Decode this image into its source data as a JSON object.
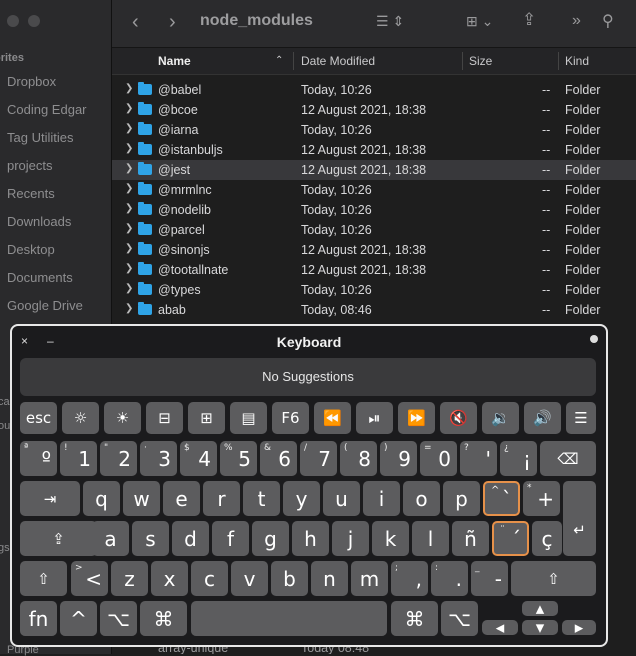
{
  "window": {
    "title": "node_modules"
  },
  "sidebar": {
    "section": "orites",
    "items": [
      "Dropbox",
      "Coding Edgar",
      "Tag Utilities",
      "projects",
      "Recents",
      "Downloads",
      "Desktop",
      "Documents",
      "Google Drive"
    ],
    "fragments": [
      "ca",
      "ou",
      "gs",
      "Purple"
    ]
  },
  "columns": {
    "name": "Name",
    "date": "Date Modified",
    "size": "Size",
    "kind": "Kind"
  },
  "rows": [
    {
      "name": "@babel",
      "date": "Today, 10:26",
      "size": "--",
      "kind": "Folder"
    },
    {
      "name": "@bcoe",
      "date": "12 August 2021, 18:38",
      "size": "--",
      "kind": "Folder"
    },
    {
      "name": "@iarna",
      "date": "Today, 10:26",
      "size": "--",
      "kind": "Folder"
    },
    {
      "name": "@istanbuljs",
      "date": "12 August 2021, 18:38",
      "size": "--",
      "kind": "Folder"
    },
    {
      "name": "@jest",
      "date": "12 August 2021, 18:38",
      "size": "--",
      "kind": "Folder",
      "selected": true
    },
    {
      "name": "@mrmlnc",
      "date": "Today, 10:26",
      "size": "--",
      "kind": "Folder"
    },
    {
      "name": "@nodelib",
      "date": "Today, 10:26",
      "size": "--",
      "kind": "Folder"
    },
    {
      "name": "@parcel",
      "date": "Today, 10:26",
      "size": "--",
      "kind": "Folder"
    },
    {
      "name": "@sinonjs",
      "date": "12 August 2021, 18:38",
      "size": "--",
      "kind": "Folder"
    },
    {
      "name": "@tootallnate",
      "date": "12 August 2021, 18:38",
      "size": "--",
      "kind": "Folder"
    },
    {
      "name": "@types",
      "date": "Today, 10:26",
      "size": "--",
      "kind": "Folder"
    },
    {
      "name": "abab",
      "date": "Today, 08:46",
      "size": "--",
      "kind": "Folder"
    }
  ],
  "bottom_row": {
    "name": "array-unique",
    "date": "Today 08:48"
  },
  "keyboard": {
    "title": "Keyboard",
    "close": "×",
    "minimize": "–",
    "suggestions": "No Suggestions",
    "fn_row": [
      "esc",
      "F6"
    ],
    "num_row": [
      {
        "main": "º",
        "alt": "ª"
      },
      {
        "main": "1",
        "alt": "!"
      },
      {
        "main": "2",
        "alt": "\""
      },
      {
        "main": "3",
        "alt": "·"
      },
      {
        "main": "4",
        "alt": "$"
      },
      {
        "main": "5",
        "alt": "%"
      },
      {
        "main": "6",
        "alt": "&"
      },
      {
        "main": "7",
        "alt": "/"
      },
      {
        "main": "8",
        "alt": "("
      },
      {
        "main": "9",
        "alt": ")"
      },
      {
        "main": "0",
        "alt": "="
      },
      {
        "main": "'",
        "alt": "?"
      },
      {
        "main": "¡",
        "alt": "¿"
      }
    ],
    "row_q": [
      "q",
      "w",
      "e",
      "r",
      "t",
      "y",
      "u",
      "i",
      "o",
      "p"
    ],
    "grave": {
      "main": "`",
      "alt": "^"
    },
    "plus": {
      "main": "+",
      "alt": "*"
    },
    "row_a": [
      "a",
      "s",
      "d",
      "f",
      "g",
      "h",
      "j",
      "k",
      "l",
      "ñ"
    ],
    "acute": {
      "main": "´",
      "alt": "¨"
    },
    "cedilla": "ç",
    "row_z_lt": {
      "main": "<",
      "alt": ">"
    },
    "row_z": [
      "z",
      "x",
      "c",
      "v",
      "b",
      "n",
      "m"
    ],
    "comma": {
      "main": ",",
      "alt": ";"
    },
    "period": {
      "main": ".",
      "alt": ":"
    },
    "minus": {
      "main": "-",
      "alt": "_"
    },
    "mods": {
      "fn": "fn",
      "ctrl": "^",
      "opt": "⌥",
      "cmd": "⌘"
    },
    "arrows": {
      "up": "▲",
      "left": "◀",
      "down": "▼",
      "right": "▶"
    }
  },
  "colors": {
    "folder": "#2fa4e7",
    "highlight": "#e6914a"
  }
}
